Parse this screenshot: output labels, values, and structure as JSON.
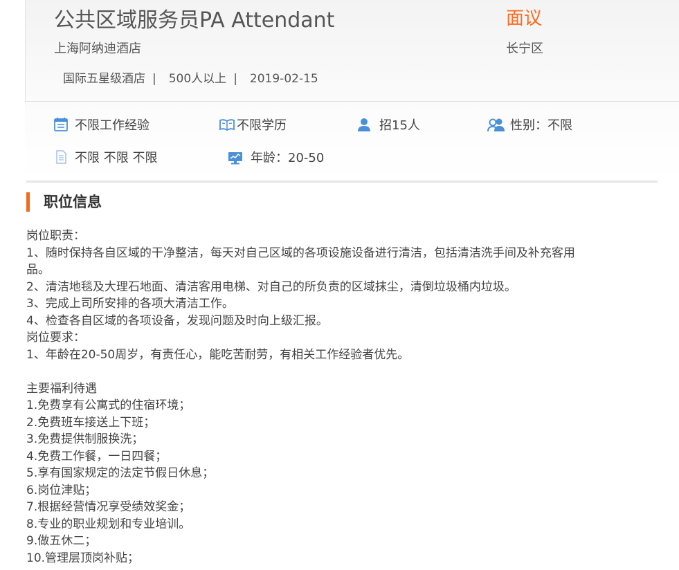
{
  "job": {
    "title": "公共区域服务员PA Attendant",
    "salary": "面议",
    "company": "上海阿纳迪酒店",
    "district": "长宁区",
    "hotel_type": "国际五星级酒店",
    "company_size": "500人以上",
    "date": "2019-02-15",
    "separator": "|"
  },
  "requirements": {
    "experience": "不限工作经验",
    "education": "不限学历",
    "headcount": "招15人",
    "gender": "性别：不限",
    "other": "不限 不限 不限",
    "age": "年龄：20-50",
    "icon_names": [
      "calendar-icon",
      "book-icon",
      "person-icon",
      "people-icon",
      "document-icon",
      "monitor-icon"
    ],
    "icon_color": "#4a90d9"
  },
  "section": {
    "title": "职位信息",
    "accent_color": "#f26b1d"
  },
  "description": {
    "lines": [
      "岗位职责：",
      "1、随时保持各自区域的干净整洁，每天对自己区域的各项设施设备进行清洁，包括清洁洗手间及补充客用",
      "品。",
      "2、清洁地毯及大理石地面、清洁客用电梯、对自己的所负责的区域抹尘，清倒垃圾桶内垃圾。",
      "3、完成上司所安排的各项大清洁工作。",
      "4、检查各自区域的各项设备，发现问题及时向上级汇报。",
      "岗位要求：",
      "1、年龄在20-50周岁，有责任心，能吃苦耐劳，有相关工作经验者优先。",
      "",
      "主要福利待遇",
      "1.免费享有公寓式的住宿环境；",
      "2.免费班车接送上下班；",
      "3.免费提供制服换洗；",
      "4.免费工作餐，一日四餐；",
      "5.享有国家规定的法定节假日休息；",
      "6.岗位津贴；",
      "7.根据经营情况享受绩效奖金；",
      "8.专业的职业规划和专业培训。",
      "9.做五休二；",
      "10.管理层顶岗补贴；"
    ]
  }
}
